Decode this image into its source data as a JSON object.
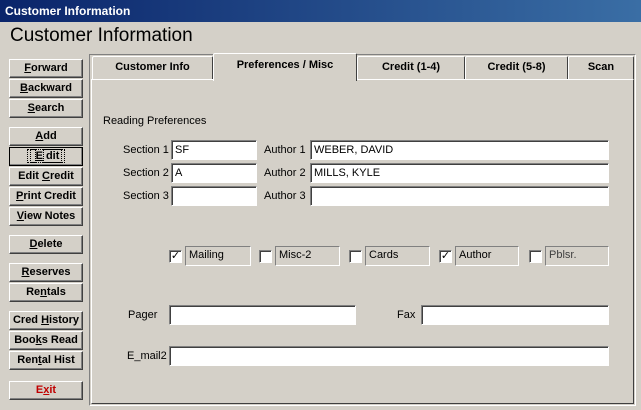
{
  "window": {
    "title": "Customer Information"
  },
  "header": {
    "title": "Customer Information"
  },
  "nav": [
    {
      "id": "forward",
      "pre": "",
      "key": "F",
      "post": "orward"
    },
    {
      "id": "backward",
      "pre": "",
      "key": "B",
      "post": "ackward"
    },
    {
      "id": "search",
      "pre": "",
      "key": "S",
      "post": "earch"
    },
    {
      "id": "add",
      "pre": "",
      "key": "A",
      "post": "dd"
    },
    {
      "id": "edit",
      "pre": "",
      "key": "E",
      "post": "dit"
    },
    {
      "id": "edit-credit",
      "pre": "Edit ",
      "key": "C",
      "post": "redit"
    },
    {
      "id": "print-credit",
      "pre": "",
      "key": "P",
      "post": "rint Credit"
    },
    {
      "id": "view-notes",
      "pre": "",
      "key": "V",
      "post": "iew Notes"
    },
    {
      "id": "delete",
      "pre": "",
      "key": "D",
      "post": "elete"
    },
    {
      "id": "reserves",
      "pre": "",
      "key": "R",
      "post": "eserves"
    },
    {
      "id": "rentals",
      "pre": "Re",
      "key": "n",
      "post": "tals"
    },
    {
      "id": "cred-history",
      "pre": "Cred ",
      "key": "H",
      "post": "istory"
    },
    {
      "id": "books-read",
      "pre": "Boo",
      "key": "k",
      "post": "s Read"
    },
    {
      "id": "rental-hist",
      "pre": "Ren",
      "key": "t",
      "post": "al Hist"
    },
    {
      "id": "exit",
      "pre": "E",
      "key": "x",
      "post": "it"
    }
  ],
  "tabs": [
    {
      "label": "Customer Info",
      "active": false
    },
    {
      "label": "Preferences / Misc",
      "active": true
    },
    {
      "label": "Credit (1-4)",
      "active": false
    },
    {
      "label": "Credit (5-8)",
      "active": false
    },
    {
      "label": "Scan",
      "active": false
    }
  ],
  "preferences": {
    "group_label": "Reading Preferences",
    "section1_label": "Section 1",
    "section1_value": "SF",
    "section2_label": "Section 2",
    "section2_value": "A",
    "section3_label": "Section 3",
    "section3_value": "",
    "author1_label": "Author 1",
    "author1_value": "WEBER, DAVID",
    "author2_label": "Author 2",
    "author2_value": "MILLS, KYLE",
    "author3_label": "Author 3",
    "author3_value": ""
  },
  "checkboxes": [
    {
      "label": "Mailing",
      "checked": true
    },
    {
      "label": "Misc-2",
      "checked": false
    },
    {
      "label": "Cards",
      "checked": false
    },
    {
      "label": "Author",
      "checked": true
    },
    {
      "label": "Pblsr.",
      "checked": false
    }
  ],
  "contact": {
    "pager_label": "Pager",
    "pager_value": "",
    "fax_label": "Fax",
    "fax_value": "",
    "email2_label": "E_mail2",
    "email2_value": ""
  }
}
